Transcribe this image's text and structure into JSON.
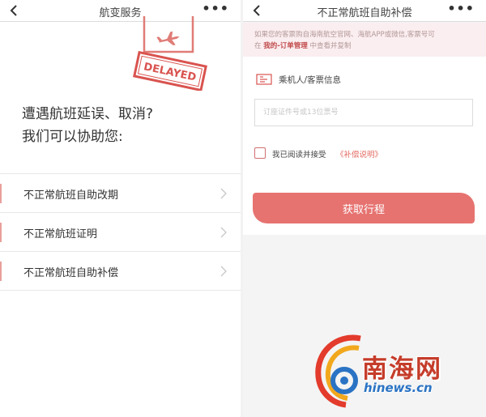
{
  "left": {
    "nav": {
      "title": "航变服务",
      "more": "•••"
    },
    "stamp": {
      "text": "DELAYED"
    },
    "headline": {
      "line1": "遭遇航班延误、取消?",
      "line2": "我们可以协助您:"
    },
    "menu": [
      {
        "label": "不正常航班自助改期"
      },
      {
        "label": "不正常航班证明"
      },
      {
        "label": "不正常航班自助补偿"
      }
    ]
  },
  "right": {
    "nav": {
      "title": "不正常航班自助补偿",
      "more": "•••"
    },
    "notice": {
      "text": "如果您的客票购自海南航空官网、海航APP或微信,客票号可",
      "prefix": "在",
      "link": "我的-订单管理",
      "suffix": "中查看并复制"
    },
    "section": {
      "title": "乘机人/客票信息"
    },
    "input": {
      "value": "",
      "placeholder": "订座证件号或13位票号"
    },
    "agreement": {
      "text": "我已阅读并接受",
      "link": "《补偿说明》"
    },
    "button": {
      "label": "获取行程"
    }
  },
  "watermark": {
    "cn": "南海网",
    "en": "hinews.cn"
  },
  "colors": {
    "accent": "#e67370",
    "link": "#e36b62",
    "notice_bg": "#fbeef0",
    "stamp": "#d9534f"
  }
}
